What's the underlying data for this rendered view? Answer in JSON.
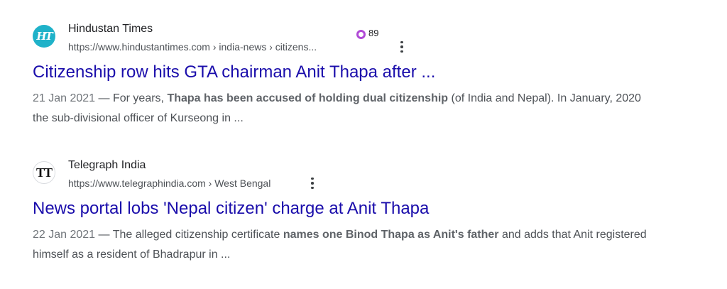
{
  "results": [
    {
      "site_name": "Hindustan Times",
      "favicon_text": "HT",
      "favicon_color": "#1fb2c9",
      "url": "https://www.hindustantimes.com › india-news › citizens...",
      "badge_count": "89",
      "badge_color": "#b04ad6",
      "title": "Citizenship row hits GTA chairman Anit Thapa after ...",
      "date": "21 Jan 2021",
      "dash": " — ",
      "snippet_before": "For years, ",
      "snippet_bold": "Thapa has been accused of holding dual citizenship",
      "snippet_after": " (of India and Nepal). In January, 2020 the sub-divisional officer of Kurseong in ..."
    },
    {
      "site_name": "Telegraph India",
      "favicon_text": "TT",
      "url": "https://www.telegraphindia.com › West Bengal",
      "title": "News portal lobs 'Nepal citizen' charge at Anit Thapa",
      "date": "22 Jan 2021",
      "dash": " — ",
      "snippet_before": "The alleged citizenship certificate ",
      "snippet_bold": "names one Binod Thapa as Anit's father",
      "snippet_after": " and adds that Anit registered himself as a resident of Bhadrapur in ..."
    }
  ],
  "colors": {
    "link": "#1a0dab",
    "text": "#4d5156",
    "site": "#202124"
  },
  "icons": {
    "more_options": "three-dots-vertical-icon",
    "badge": "ring-icon"
  }
}
